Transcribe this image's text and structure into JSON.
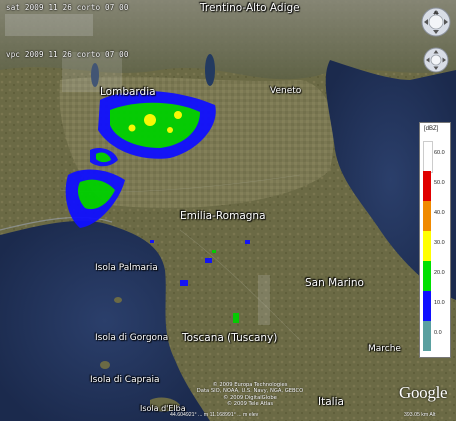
{
  "header": {
    "timestamp_1": "sat 2009 11 26 corto 07 00",
    "timestamp_2": "vpc 2009 11 26 corto 07 00"
  },
  "places": {
    "trentino": "Trentino-Alto Adige",
    "lombardia": "Lombardia",
    "veneto": "Veneto",
    "emilia": "Emilia-Romagna",
    "isola_palmaria": "Isola Palmaria",
    "san_marino": "San Marino",
    "isola_gorgona": "Isola di Gorgona",
    "toscana": "Toscana (Tuscany)",
    "marche": "Marche",
    "isola_capraia": "Isola di Capraia",
    "isola_elba": "Isola d'Elba",
    "italia": "Italia"
  },
  "footer": {
    "credit_1": "© 2009 Europa Technologies",
    "credit_2": "Data SIO, NOAA, U.S. Navy, NGA, GEBCO",
    "credit_3": "© 2009 DigitalGlobe",
    "credit_4": "© 2009 Tele Atlas",
    "coordinates": "44.604921°   ... m   11.168991° ... m elev",
    "eye_alt": "393.05 km  Alt",
    "logo": "Google"
  },
  "legend": {
    "unit": "[dBZ]",
    "ticks": [
      "60.0",
      "50.0",
      "40.0",
      "30.0",
      "20.0",
      "10.0",
      "0.0"
    ],
    "colors": [
      "#ffffff",
      "#e00000",
      "#f08a00",
      "#ffff00",
      "#00e000",
      "#1010ff",
      "#5aa0a0"
    ]
  },
  "controls": {
    "look_icon": "look-joystick-icon",
    "move_icon": "move-joystick-icon"
  }
}
